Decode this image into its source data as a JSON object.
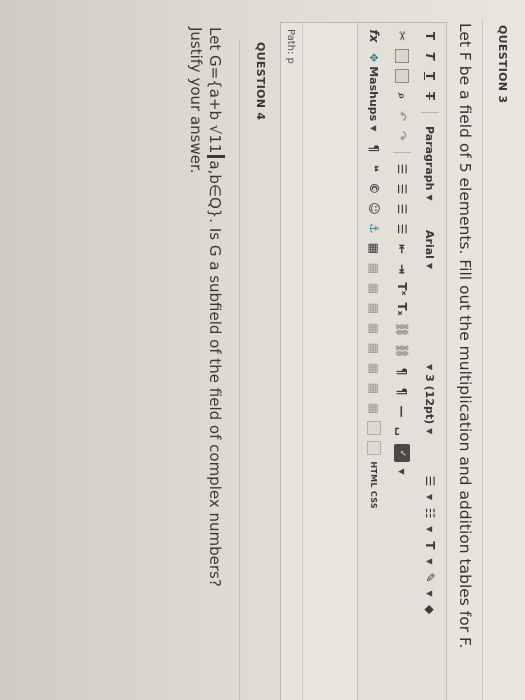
{
  "question3": {
    "heading": "QUESTION 3",
    "text": "Let F be a field of 5 elements. Fill out the multiplication and addition tables for F."
  },
  "editor": {
    "row1": {
      "format_buttons": [
        "T",
        "T",
        "T",
        "T"
      ],
      "paragraph_label": "Paragraph",
      "font_label": "Arial",
      "size_label": "3 (12pt)",
      "text_color_glyph": "T"
    },
    "row2": {
      "superscript_glyph": "Tˣ",
      "subscript_glyph": "Tₓ"
    },
    "row3": {
      "fx_glyph": "fx",
      "mashups_label": "Mashups",
      "html_css_label": "HTML CSS"
    },
    "path_label": "Path: p"
  },
  "question4": {
    "heading": "QUESTION 4",
    "line1_before": "Let G={a+b √11",
    "line1_after": "a,b∈Q}. Is G a subfield of the field of complex numbers?",
    "line2": "Justify your answer."
  }
}
